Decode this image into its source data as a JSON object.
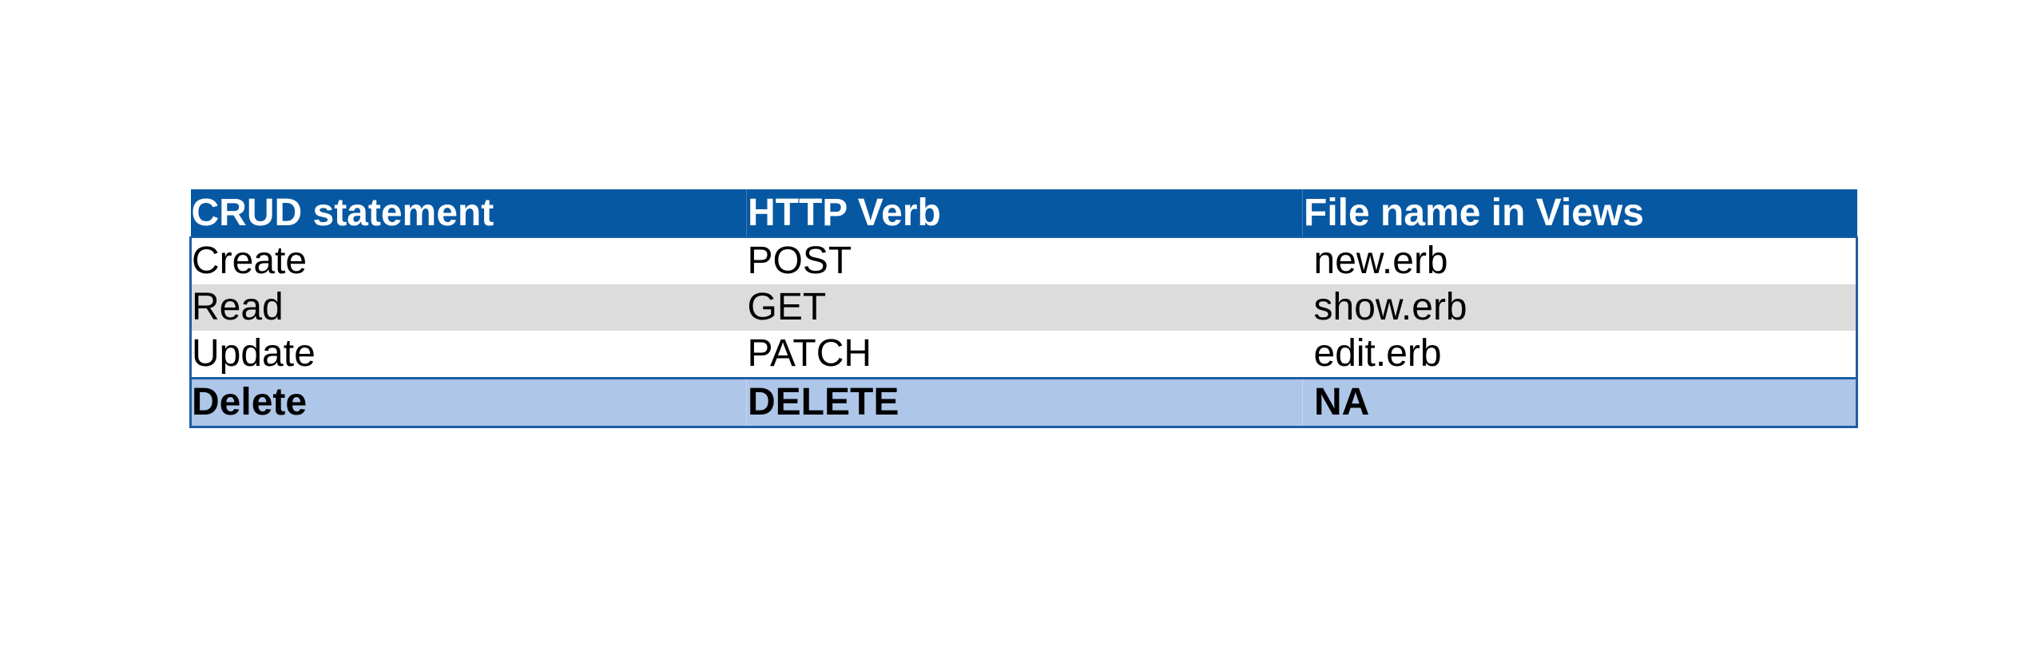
{
  "table": {
    "headers": [
      "CRUD statement",
      "HTTP Verb",
      "File name in Views"
    ],
    "rows": [
      [
        "Create",
        "POST",
        "new.erb"
      ],
      [
        "Read",
        "GET",
        "show.erb"
      ],
      [
        "Update",
        "PATCH",
        "edit.erb"
      ]
    ],
    "total_row": [
      "Delete",
      "DELETE",
      "NA"
    ]
  },
  "colors": {
    "header_bg": "#0658a3",
    "header_text": "#ffffff",
    "stripe_bg": "#dcdcdc",
    "total_bg": "#aec6e8",
    "border": "#1e5ea3"
  }
}
